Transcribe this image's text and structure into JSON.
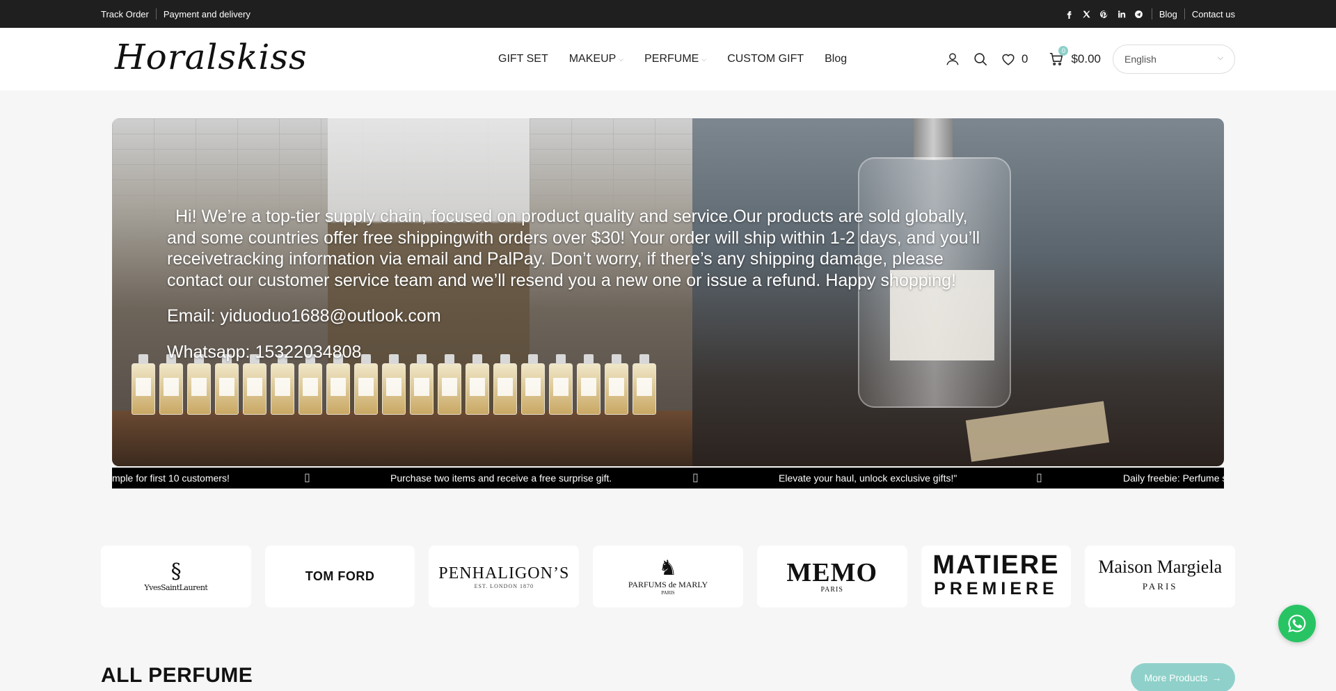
{
  "topbar": {
    "left_links": [
      "Track Order",
      "Payment and delivery"
    ],
    "social_icons": [
      "facebook-icon",
      "x-icon",
      "pinterest-icon",
      "linkedin-icon",
      "telegram-icon"
    ],
    "right_links": [
      "Blog",
      "Contact us"
    ]
  },
  "header": {
    "logo_text": "Horalskiss",
    "nav": [
      {
        "label": "GIFT SET",
        "dropdown": false
      },
      {
        "label": "MAKEUP",
        "dropdown": true
      },
      {
        "label": "PERFUME",
        "dropdown": true
      },
      {
        "label": "CUSTOM GIFT",
        "dropdown": false
      },
      {
        "label": "Blog",
        "dropdown": false
      }
    ],
    "wishlist_count": "0",
    "cart_count": "0",
    "cart_total": "$0.00",
    "language": "English"
  },
  "hero": {
    "message": "Hi! We’re a top-tier supply chain, focused on product quality and service.Our products are sold globally, and some countries offer free shippingwith orders over $30! Your order will ship within 1-2 days, and you’ll receivetracking information via email and PalPay. Don’t worry, if there’s any shipping damage, please contact our customer service team and we’ll resend you a new one or issue a refund. Happy shopping!",
    "email": "Email: yiduoduo1688@outlook.com",
    "whatsapp": "Whatsapp: 15322034808"
  },
  "marquee": {
    "items": [
      "mple for first 10 customers!",
      "Purchase two items and receive a free surprise gift.",
      "Elevate your haul, unlock exclusive gifts!\"",
      "Daily freebie: Perfume s"
    ],
    "separator": "▯"
  },
  "brands": {
    "ysl": "YvesSaintLaurent",
    "tomford": "TOM FORD",
    "penhaligons": "PENHALIGON’S",
    "penhaligons_sub": "EST. LONDON 1870",
    "pdm": "PARFUMS de MARLY",
    "pdm_sub": "PARIS",
    "memo": "MEMO",
    "memo_sub": "PARIS",
    "matiere_1": "MATIERE",
    "matiere_2": "PREMIERE",
    "margiela": "Maison Margiela",
    "margiela_sub": "PARIS"
  },
  "section": {
    "title": "ALL PERFUME",
    "more_button": "More Products"
  },
  "colors": {
    "topbar_bg": "#1f1f1f",
    "accent": "#8fd1ca",
    "whatsapp": "#28c464"
  }
}
